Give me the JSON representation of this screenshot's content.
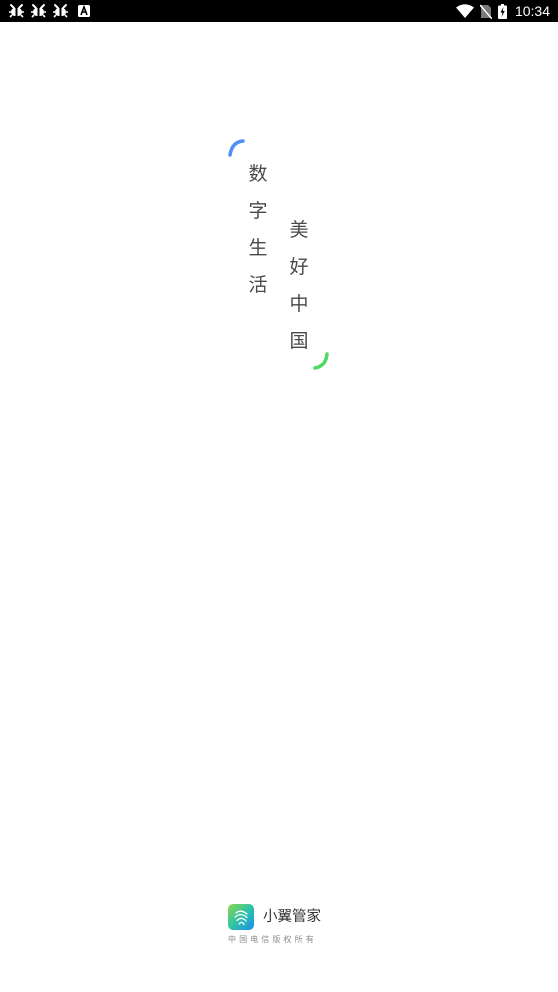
{
  "status_bar": {
    "time": "10:34",
    "left_icons": [
      "bug-icon",
      "bug-icon",
      "bug-icon",
      "a-notification-icon"
    ],
    "right_icons": [
      "wifi-icon",
      "no-sim-icon",
      "battery-charging-icon"
    ]
  },
  "slogan": {
    "left_column": [
      "数",
      "字",
      "生",
      "活"
    ],
    "right_column": [
      "美",
      "好",
      "中",
      "国"
    ],
    "colors": {
      "text": "#4a4a4a",
      "arc_top": "#4f8ff7",
      "arc_bottom": "#4cd964"
    }
  },
  "footer": {
    "app_name": "小翼管家",
    "copyright": "中国电信版权所有"
  }
}
